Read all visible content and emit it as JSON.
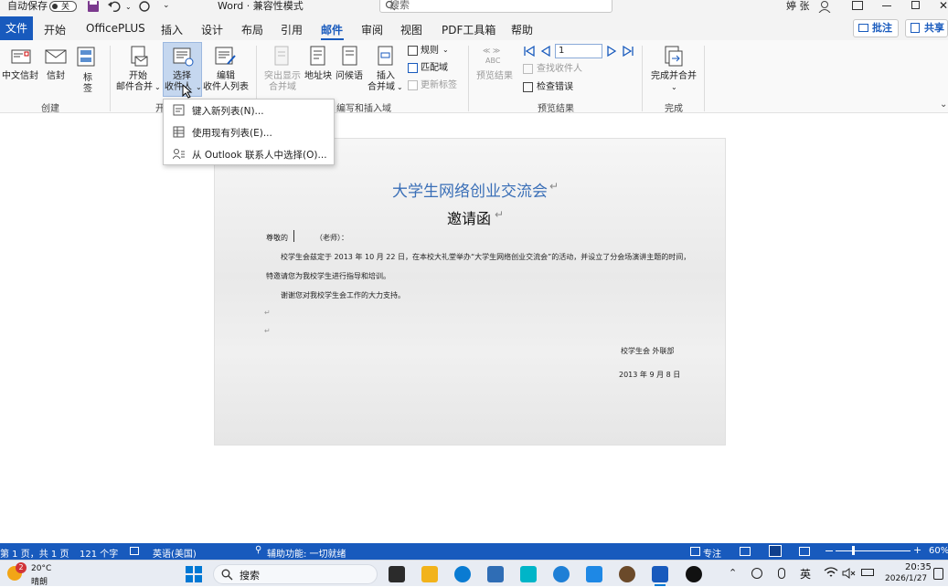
{
  "titlebar": {
    "autosave_label": "自动保存",
    "autosave_state": "关",
    "document_title": "Word · 兼容性模式",
    "search_placeholder": "搜索",
    "user_name": "婷 张"
  },
  "tabs": {
    "file": "文件",
    "items": [
      "开始",
      "OfficePLUS",
      "插入",
      "设计",
      "布局",
      "引用",
      "邮件",
      "审阅",
      "视图",
      "PDF工具箱",
      "帮助"
    ],
    "active": "邮件",
    "comments_button": "批注",
    "share_button": "共享"
  },
  "ribbon": {
    "create": {
      "group_label": "创建",
      "chinese_envelope": "中文信封",
      "envelope": "信封",
      "label_line1": "标",
      "label_line2": "签"
    },
    "start_merge": {
      "group_label": "开",
      "start_line1": "开始",
      "start_line2": "邮件合并",
      "select_line1": "选择",
      "select_line2": "收件人",
      "edit_line1": "编辑",
      "edit_line2": "收件人列表"
    },
    "write_insert": {
      "group_label": "编写和插入域",
      "highlight_line1": "突出显示",
      "highlight_line2": "合并域",
      "address_block": "地址块",
      "greeting_line": "问候语",
      "insert_line1": "插入",
      "insert_line2": "合并域",
      "rules": "规则",
      "match_fields": "匹配域",
      "update_labels": "更新标签"
    },
    "preview": {
      "group_label": "预览结果",
      "abc": "ABC",
      "preview_results": "预览结果",
      "record_number": "1",
      "find_recipient": "查找收件人",
      "check_errors": "检查错误"
    },
    "finish": {
      "group_label": "完成",
      "finish_merge": "完成并合并"
    }
  },
  "dropdown_menu": {
    "items": [
      "键入新列表(N)...",
      "使用现有列表(E)...",
      "从 Outlook 联系人中选择(O)..."
    ]
  },
  "document": {
    "heading": "大学生网络创业交流会",
    "title": "邀请函",
    "salutation": "尊敬的",
    "teacher": "（老师）：",
    "body_line1": "校学生会兹定于 2013 年 10 月 22 日，在本校大礼堂举办“大学生网络创业交流会”的活动，并设立了分会场演讲主题的时间，",
    "body_line2": "特邀请您为我校学生进行指导和培训。",
    "body_line3": "谢谢您对我校学生会工作的大力支持。",
    "signature": "校学生会  外联部",
    "date": "2013 年 9 月 8 日",
    "para_mark": "↵"
  },
  "statusbar": {
    "page_info": "第 1 页，共 1 页",
    "word_count": "121 个字",
    "language": "英语(美国)",
    "accessibility": "辅助功能: 一切就绪",
    "focus": "专注",
    "zoom": "60%"
  },
  "taskbar": {
    "weather_badge": "2",
    "temperature": "20°C",
    "weather": "晴朗",
    "search_label": "搜索",
    "ime": "英",
    "time": "20:35",
    "date": "2026/1/27"
  },
  "colors": {
    "accent": "#185abd",
    "heading_blue": "#3a6fb7"
  },
  "icons": [
    "save-icon",
    "undo-icon",
    "redo-icon",
    "search-icon",
    "envelope-icon",
    "label-icon",
    "mail-merge-icon",
    "recipients-icon",
    "edit-list-icon",
    "first-record-icon",
    "prev-record-icon",
    "next-record-icon",
    "last-record-icon",
    "finish-merge-icon",
    "windows-start-icon",
    "wifi-icon",
    "volume-icon"
  ]
}
